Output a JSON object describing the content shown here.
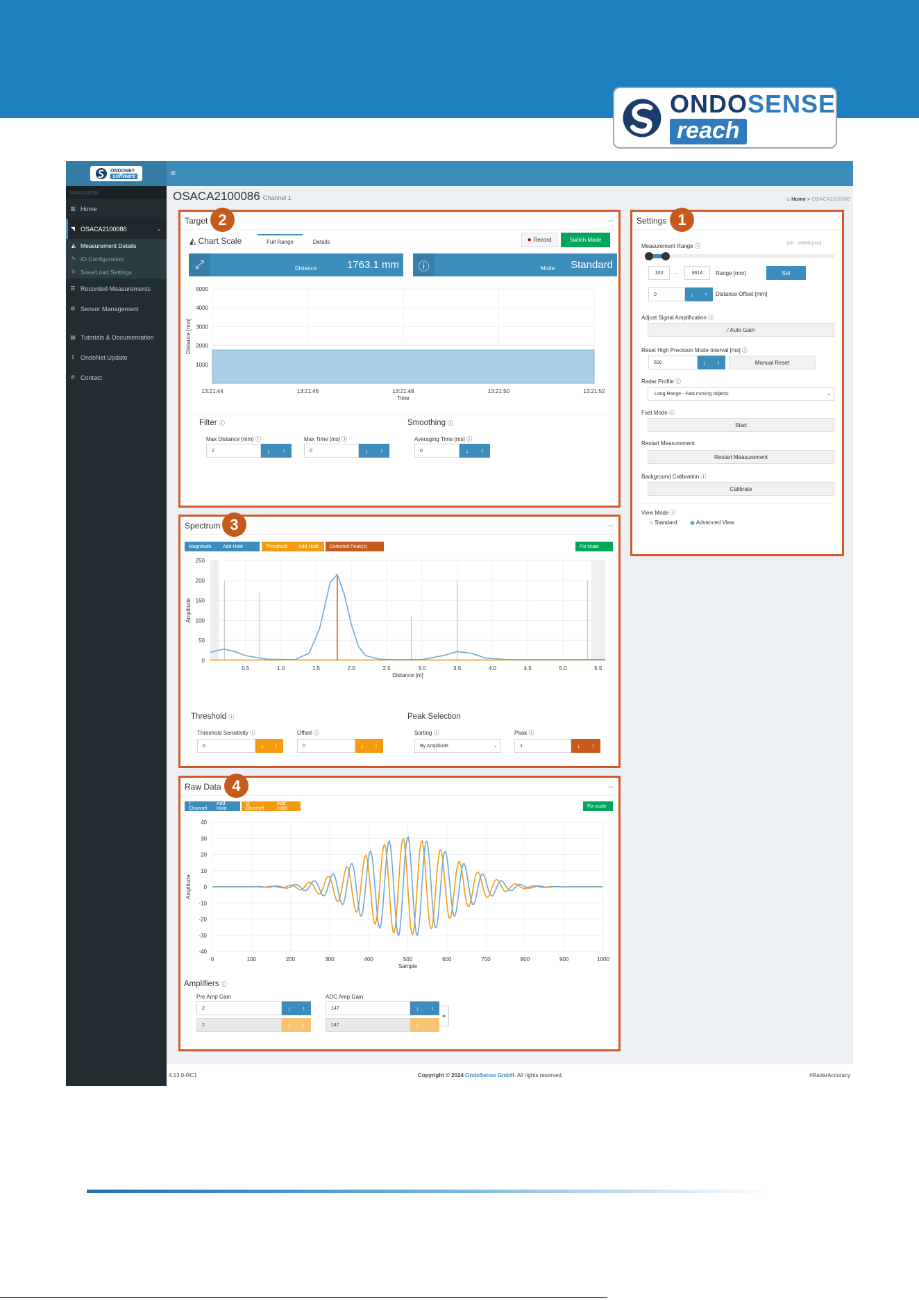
{
  "brand": {
    "name_bold": "ONDO",
    "name_light": "SENSE",
    "sub": "reach"
  },
  "sidebar": {
    "logo_top": "ONDONET",
    "logo_bottom": "software",
    "header": "NAVIGATION",
    "items": [
      {
        "label": "Home",
        "icon": "bar-chart-icon"
      },
      {
        "label": "OSACA2100086",
        "icon": "rss-icon"
      }
    ],
    "sub_items": [
      {
        "label": "Measurement Details",
        "icon": "area-chart-icon"
      },
      {
        "label": "IO Configuration",
        "icon": "plug-icon"
      },
      {
        "label": "Save/Load Settings",
        "icon": "refresh-icon"
      }
    ],
    "items2": [
      {
        "label": "Recorded Measurements",
        "icon": "database-icon"
      },
      {
        "label": "Sensor Management",
        "icon": "gear-icon"
      },
      {
        "label": "Tutorials & Documentation",
        "icon": "book-icon"
      },
      {
        "label": "OndoNet Update",
        "icon": "download-icon"
      },
      {
        "label": "Contact",
        "icon": "phone-icon"
      }
    ]
  },
  "topbar": {
    "menu_icon": "≡"
  },
  "header": {
    "title": "OSACA2100086",
    "subtitle": "Channel 1",
    "breadcrumb_home": "Home",
    "breadcrumb_current": "OSACA2100086"
  },
  "settings": {
    "title": "Settings",
    "badge": "1",
    "measurement_range_label": "Measurement Range",
    "range_hint": "100 - 100000 [mm]",
    "range_from": "100",
    "range_sep": "-",
    "range_to": "9614",
    "range_unit": "Range [mm]",
    "set_label": "Set",
    "distance_offset_value": "0",
    "distance_offset_label": "Distance Offset [mm]",
    "signal_amp_label": "Adjust Signal Amplification",
    "auto_gain_label": "Auto Gain",
    "reset_hp_label": "Reset High Precision Mode Interval [ms]",
    "reset_hp_value": "500",
    "manual_reset_label": "Manual Reset",
    "radar_profile_label": "Radar Profile",
    "radar_profile_value": "Long Range - Fast moving objects",
    "fast_mode_label": "Fast Mode",
    "start_label": "Start",
    "restart_label": "Restart Measurement",
    "restart_button": "Restart Measurement",
    "bg_cal_label": "Background Calibration",
    "calibrate_label": "Calibrate",
    "view_mode_label": "View Mode",
    "view_standard": "Standard",
    "view_advanced": "Advanced View"
  },
  "target": {
    "title": "Target",
    "badge": "2",
    "chart_scale": "Chart Scale",
    "tab_full": "Full Range",
    "tab_details": "Details",
    "record_label": "Record",
    "switch_mode_label": "Switch Mode",
    "distance_label": "Distance",
    "distance_value": "1763.1 mm",
    "mode_label": "Mode",
    "mode_value": "Standard",
    "filter_title": "Filter",
    "max_distance_label": "Max Distance [mm]",
    "max_distance_value": "2",
    "max_time_label": "Max Time [ms]",
    "max_time_value": "0",
    "smoothing_title": "Smoothing",
    "averaging_label": "Averaging Time [ms]",
    "averaging_value": "0"
  },
  "spectrum": {
    "title": "Spectrum",
    "badge": "3",
    "chip_magnitude": "Magnitude",
    "chip_add_hold": "Add Hold",
    "chip_threshold": "Threshold",
    "chip_add_hold2": "Add Hold",
    "chip_detected": "Detected Peak(s)",
    "fix_scale": "Fix scale",
    "threshold_title": "Threshold",
    "threshold_sens_label": "Threshold Sensitivity",
    "threshold_sens_value": "0",
    "offset_label": "Offset",
    "offset_value": "0",
    "peak_selection_title": "Peak Selection",
    "sorting_label": "Sorting",
    "sorting_value": "By Amplitude",
    "peak_label": "Peak",
    "peak_value": "1"
  },
  "rawdata": {
    "title": "Raw Data",
    "badge": "4",
    "chip_i": "I Channel",
    "chip_add_hold": "Add Hold",
    "chip_q": "Q Channel",
    "chip_add_hold2": "Add Hold",
    "fix_scale": "Fix scale",
    "amplifiers_title": "Amplifiers",
    "pre_amp_label": "Pre Amp Gain",
    "pre_amp_i": "2",
    "pre_amp_q": "2",
    "adc_amp_label": "ADC Amp Gain",
    "adc_amp_i": "147",
    "adc_amp_q": "147"
  },
  "footer": {
    "version": "4.13.0-RC1",
    "copyright_pre": "Copyright © 2024 ",
    "copyright_link": "OndoSense GmbH",
    "copyright_post": ". All rights reserved.",
    "hashtag": "#RadarAccuracy"
  },
  "colors": {
    "blue": "#3c8dbc",
    "orange": "#f39c12",
    "dark_orange": "#c55a1b",
    "green": "#00a65a",
    "frame": "#d25a24"
  },
  "chart_data": [
    {
      "type": "area",
      "title": "",
      "xlabel": "Time",
      "ylabel": "Distance [mm]",
      "x": [
        "13:21:44",
        "13:21:46",
        "13:21:48",
        "13:21:50",
        "13:21:52"
      ],
      "series": [
        {
          "values": [
            1763,
            1763,
            1763,
            1763,
            1763
          ]
        }
      ],
      "ylim": [
        0,
        5000
      ],
      "yticks": [
        1000,
        2000,
        3000,
        4000,
        5000
      ]
    },
    {
      "type": "line",
      "title": "",
      "xlabel": "Distance [m]",
      "ylabel": "Amplitude",
      "xlim": [
        0,
        5.6
      ],
      "ylim": [
        0,
        250
      ],
      "xticks": [
        0.5,
        1.0,
        1.5,
        2.0,
        2.5,
        3.0,
        3.5,
        4.0,
        4.5,
        5.0,
        5.5
      ],
      "yticks": [
        0,
        50,
        100,
        150,
        200,
        250
      ],
      "series": [
        {
          "name": "Magnitude",
          "x": [
            0,
            0.1,
            0.2,
            0.35,
            0.5,
            0.8,
            1.2,
            1.4,
            1.55,
            1.7,
            1.8,
            1.9,
            2.0,
            2.1,
            2.2,
            2.4,
            2.6,
            3.0,
            3.3,
            3.5,
            3.7,
            3.9,
            4.2,
            5.6
          ],
          "values": [
            20,
            25,
            28,
            22,
            12,
            3,
            2,
            18,
            80,
            195,
            215,
            165,
            90,
            35,
            12,
            3,
            2,
            2,
            12,
            22,
            18,
            6,
            2,
            2
          ]
        },
        {
          "name": "Detected Peak(s)",
          "x": [
            1.8
          ],
          "values": [
            210
          ]
        }
      ]
    },
    {
      "type": "line",
      "title": "",
      "xlabel": "Sample",
      "ylabel": "Amplitude",
      "xlim": [
        0,
        1000
      ],
      "ylim": [
        -40,
        40
      ],
      "xticks": [
        0,
        100,
        200,
        300,
        400,
        500,
        600,
        700,
        800,
        900,
        1000
      ],
      "yticks": [
        -40,
        -30,
        -20,
        -10,
        0,
        10,
        20,
        30,
        40
      ],
      "series": [
        {
          "name": "I Channel",
          "center": 500,
          "amplitude": 31,
          "period": 48,
          "width": 165,
          "phase": 0
        },
        {
          "name": "Q Channel",
          "center": 500,
          "amplitude": 30,
          "period": 48,
          "width": 165,
          "phase": 1.57
        }
      ]
    }
  ]
}
